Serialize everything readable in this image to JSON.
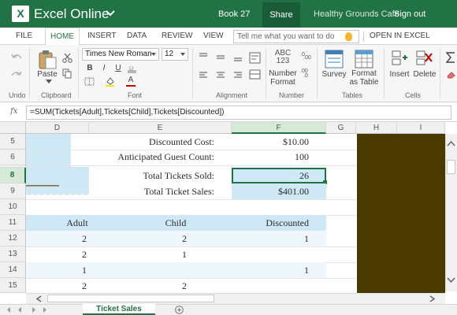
{
  "titlebar": {
    "app_name": "Excel Online",
    "book_name": "Book 27",
    "share_label": "Share",
    "company": "Healthy Grounds Cafe",
    "signout_label": "Sign out"
  },
  "ribbon_tabs": [
    "FILE",
    "HOME",
    "INSERT",
    "DATA",
    "REVIEW",
    "VIEW"
  ],
  "active_tab": "HOME",
  "tell_me": {
    "placeholder": "Tell me what you want to do"
  },
  "open_in_excel_label": "OPEN IN EXCEL",
  "ribbon": {
    "groups": {
      "undo": "Undo",
      "clipboard": "Clipboard",
      "font": "Font",
      "alignment": "Alignment",
      "number": "Number",
      "tables": "Tables",
      "cells": "Cells"
    },
    "paste_label": "Paste",
    "font_name": "Times New Roman",
    "font_size": "12",
    "bold": "B",
    "italic": "I",
    "underline": "U",
    "font_color_glyph": "A",
    "number_format_icon_text": "ABC 123",
    "number_format_label": "Number Format",
    "survey_label": "Survey",
    "format_table_label": "Format as Table",
    "insert_label": "Insert",
    "delete_label": "Delete"
  },
  "formula_bar": {
    "fx": "fx",
    "formula": "=SUM(Tickets[Adult],Tickets[Child],Tickets[Discounted])"
  },
  "columns": [
    "D",
    "E",
    "F",
    "G",
    "H",
    "I"
  ],
  "selected_column": "F",
  "rows": [
    "5",
    "6",
    "7",
    "8",
    "9",
    "10",
    "11",
    "12",
    "13",
    "14",
    "15"
  ],
  "selected_row": "8",
  "summary": {
    "discounted_cost_label": "Discounted Cost:",
    "discounted_cost_value": "$10.00",
    "guest_count_label": "Anticipated Guest Count:",
    "guest_count_value": "100",
    "total_sold_label": "Total Tickets Sold:",
    "total_sold_value": "26",
    "total_sales_label": "Total Ticket Sales:",
    "total_sales_value": "$401.00"
  },
  "table": {
    "headers": [
      "Adult",
      "Child",
      "Discounted"
    ],
    "rows": [
      [
        "2",
        "2",
        "1"
      ],
      [
        "2",
        "1",
        ""
      ],
      [
        "1",
        "",
        "1"
      ],
      [
        "2",
        "2",
        ""
      ]
    ]
  },
  "sheet_tabs": [
    "Ticket Sales"
  ],
  "colors": {
    "accent": "#217346",
    "table_header_fill": "#cfe8f6",
    "total_fill": "#cfe8f6",
    "dark_block": "#4a3a00"
  }
}
